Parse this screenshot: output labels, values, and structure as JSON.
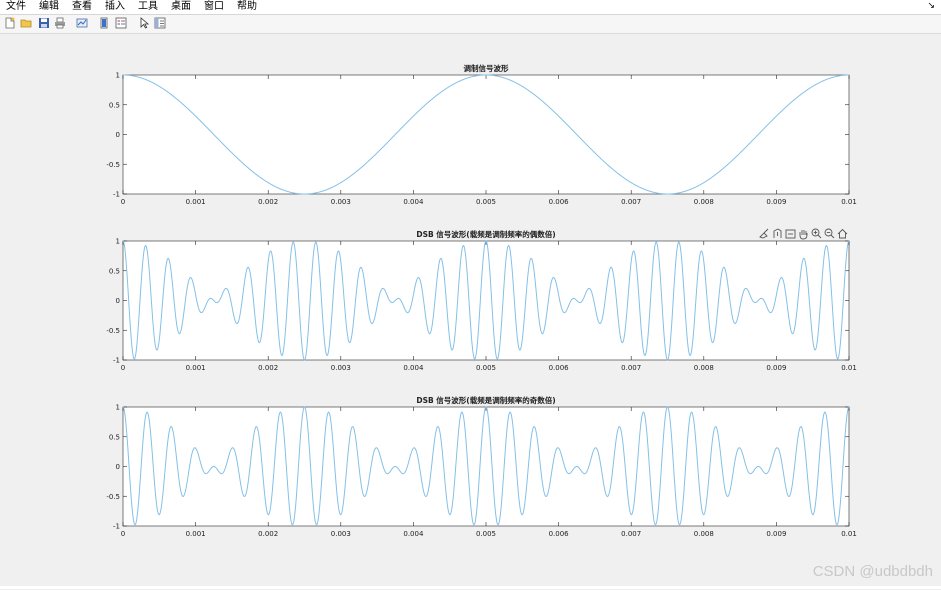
{
  "menu": [
    "文件",
    "编辑",
    "查看",
    "插入",
    "工具",
    "桌面",
    "窗口",
    "帮助"
  ],
  "menu_arrow": "↘",
  "toolbar_icons": [
    "new-file-icon",
    "open-folder-icon",
    "save-icon",
    "print-icon",
    "link-plot-icon",
    "insert-colorbar-icon",
    "insert-legend-icon",
    "pointer-icon",
    "property-editor-icon"
  ],
  "axes_toolbar_icons": [
    "brush-icon",
    "data-tips-icon",
    "export-icon",
    "pan-hand-icon",
    "zoom-in-icon",
    "zoom-out-icon",
    "home-icon"
  ],
  "watermark": "CSDN @udbdbdh",
  "colors": {
    "line": "#84c0e8",
    "axes_bg": "#ffffff",
    "figure_bg": "#f0f0f0"
  },
  "chart_data": [
    {
      "type": "line",
      "title": "调制信号波形",
      "xlim": [
        0,
        0.01
      ],
      "ylim": [
        -1,
        1
      ],
      "xticks": [
        "0",
        "0.001",
        "0.002",
        "0.003",
        "0.004",
        "0.005",
        "0.006",
        "0.007",
        "0.008",
        "0.009",
        "0.01"
      ],
      "yticks": [
        "-1",
        "-0.5",
        "0",
        "0.5",
        "1"
      ],
      "series": [
        {
          "function": "cos(2*pi*fm*t)",
          "fm_hz": 200
        }
      ]
    },
    {
      "type": "line",
      "title": "DSB 信号波形(载频是调制频率的偶数倍)",
      "xlim": [
        0,
        0.01
      ],
      "ylim": [
        -1,
        1
      ],
      "xticks": [
        "0",
        "0.001",
        "0.002",
        "0.003",
        "0.004",
        "0.005",
        "0.006",
        "0.007",
        "0.008",
        "0.009",
        "0.01"
      ],
      "yticks": [
        "-1",
        "-0.5",
        "0",
        "0.5",
        "1"
      ],
      "series": [
        {
          "function": "cos(2*pi*fm*t)*cos(2*pi*fc*t)",
          "fm_hz": 200,
          "fc_hz": 3200
        }
      ]
    },
    {
      "type": "line",
      "title": "DSB 信号波形(载频是调制频率的奇数倍)",
      "xlim": [
        0,
        0.01
      ],
      "ylim": [
        -1,
        1
      ],
      "xticks": [
        "0",
        "0.001",
        "0.002",
        "0.003",
        "0.004",
        "0.005",
        "0.006",
        "0.007",
        "0.008",
        "0.009",
        "0.01"
      ],
      "yticks": [
        "-1",
        "-0.5",
        "0",
        "0.5",
        "1"
      ],
      "series": [
        {
          "function": "cos(2*pi*fm*t)*cos(2*pi*fc*t)",
          "fm_hz": 200,
          "fc_hz": 3000
        }
      ]
    }
  ]
}
